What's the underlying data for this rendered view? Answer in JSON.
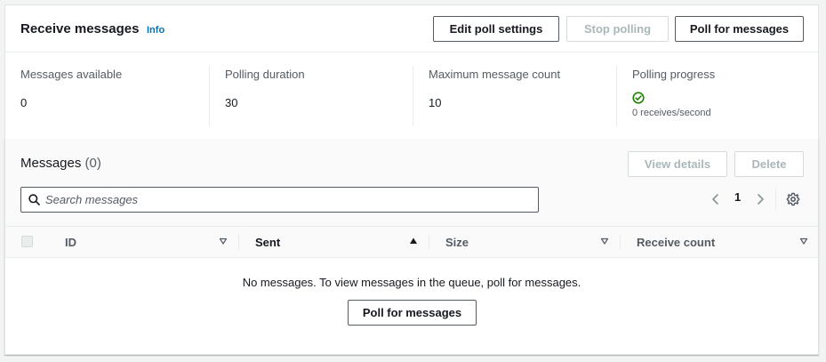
{
  "header": {
    "title": "Receive messages",
    "info": "Info",
    "buttons": {
      "edit": "Edit poll settings",
      "stop": "Stop polling",
      "poll": "Poll for messages"
    }
  },
  "stats": {
    "available": {
      "label": "Messages available",
      "value": "0"
    },
    "duration": {
      "label": "Polling duration",
      "value": "30"
    },
    "max_count": {
      "label": "Maximum message count",
      "value": "10"
    },
    "progress": {
      "label": "Polling progress",
      "value": "0 receives/second"
    }
  },
  "messages": {
    "title": "Messages",
    "count": "(0)",
    "view_details": "View details",
    "delete": "Delete",
    "search_placeholder": "Search messages",
    "page": "1",
    "columns": [
      "ID",
      "Sent",
      "Size",
      "Receive count"
    ],
    "empty_text": "No messages. To view messages in the queue, poll for messages.",
    "empty_button": "Poll for messages"
  },
  "colors": {
    "link": "#0073bb",
    "success": "#1d8102",
    "text": "#16191f",
    "muted": "#545b64"
  }
}
